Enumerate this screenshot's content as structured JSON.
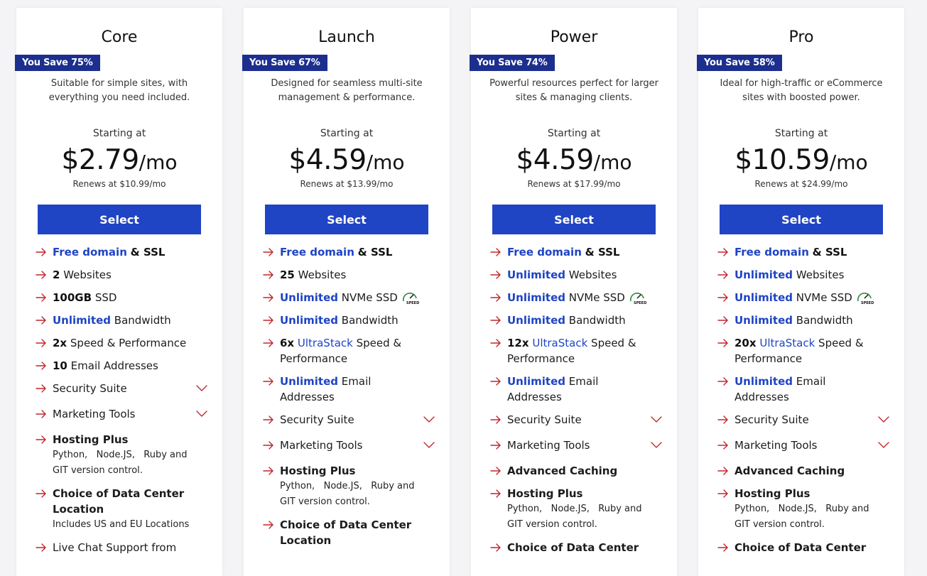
{
  "plans": [
    {
      "name": "Core",
      "badge": "You Save 75%",
      "desc1": "Suitable for simple sites, with",
      "desc2": "everything you need included.",
      "starting": "Starting at",
      "price": "$2.79",
      "per": "/mo",
      "renews": "Renews at $10.99/mo",
      "select": "Select",
      "f_domain": "Free domain",
      "f_ssl": "& SSL",
      "f_sites_n": "2",
      "f_sites": "Websites",
      "f_ssd_a": "100GB",
      "f_ssd_b": "SSD",
      "f_bw_a": "Unlimited",
      "f_bw_b": "Bandwidth",
      "f_speed_a": "2x",
      "f_speed_b": "Speed & Performance",
      "f_email_a": "10",
      "f_email_b": "Email Addresses",
      "f_security": "Security Suite",
      "f_marketing": "Marketing Tools",
      "f_hosting": "Hosting Plus",
      "f_hosting_sub1": "Python,   Node.JS,   Ruby and",
      "f_hosting_sub2": "GIT version control.",
      "f_dc1": "Choice of Data Center",
      "f_dc2": "Location",
      "f_dc_sub": "Includes US and EU Locations",
      "f_chat": "Live Chat Support from"
    },
    {
      "name": "Launch",
      "badge": "You Save 67%",
      "desc1": "Designed for seamless multi-site",
      "desc2": "management & performance.",
      "starting": "Starting at",
      "price": "$4.59",
      "per": "/mo",
      "renews": "Renews at $13.99/mo",
      "select": "Select",
      "f_domain": "Free domain",
      "f_ssl": "& SSL",
      "f_sites_n": "25",
      "f_sites": "Websites",
      "f_ssd_a": "Unlimited",
      "f_ssd_b": "NVMe SSD",
      "f_bw_a": "Unlimited",
      "f_bw_b": "Bandwidth",
      "f_speed_a": "6x",
      "f_speed_link": "UltraStack",
      "f_speed_b": "Speed &",
      "f_speed_c": "Performance",
      "f_email_a": "Unlimited",
      "f_email_b": "Email",
      "f_email_c": "Addresses",
      "f_security": "Security Suite",
      "f_marketing": "Marketing Tools",
      "f_hosting": "Hosting Plus",
      "f_hosting_sub1": "Python,   Node.JS,   Ruby and",
      "f_hosting_sub2": "GIT version control.",
      "f_dc1": "Choice of Data Center",
      "f_dc2": "Location"
    },
    {
      "name": "Power",
      "badge": "You Save 74%",
      "desc1": "Powerful resources perfect for larger",
      "desc2": "sites & managing clients.",
      "starting": "Starting at",
      "price": "$4.59",
      "per": "/mo",
      "renews": "Renews at $17.99/mo",
      "select": "Select",
      "f_domain": "Free domain",
      "f_ssl": "& SSL",
      "f_sites_n": "Unlimited",
      "f_sites": "Websites",
      "f_ssd_a": "Unlimited",
      "f_ssd_b": "NVMe SSD",
      "f_bw_a": "Unlimited",
      "f_bw_b": "Bandwidth",
      "f_speed_a": "12x",
      "f_speed_link": "UltraStack",
      "f_speed_b": "Speed &",
      "f_speed_c": "Performance",
      "f_email_a": "Unlimited",
      "f_email_b": "Email",
      "f_email_c": "Addresses",
      "f_security": "Security Suite",
      "f_marketing": "Marketing Tools",
      "f_caching": "Advanced Caching",
      "f_hosting": "Hosting Plus",
      "f_hosting_sub1": "Python,   Node.JS,   Ruby and",
      "f_hosting_sub2": "GIT version control.",
      "f_dc1": "Choice of Data Center"
    },
    {
      "name": "Pro",
      "badge": "You Save 58%",
      "desc1": "Ideal for high-traffic or eCommerce",
      "desc2": "sites with boosted power.",
      "starting": "Starting at",
      "price": "$10.59",
      "per": "/mo",
      "renews": "Renews at $24.99/mo",
      "select": "Select",
      "f_domain": "Free domain",
      "f_ssl": "& SSL",
      "f_sites_n": "Unlimited",
      "f_sites": "Websites",
      "f_ssd_a": "Unlimited",
      "f_ssd_b": "NVMe SSD",
      "f_bw_a": "Unlimited",
      "f_bw_b": "Bandwidth",
      "f_speed_a": "20x",
      "f_speed_link": "UltraStack",
      "f_speed_b": "Speed &",
      "f_speed_c": "Performance",
      "f_email_a": "Unlimited",
      "f_email_b": "Email",
      "f_email_c": "Addresses",
      "f_security": "Security Suite",
      "f_marketing": "Marketing Tools",
      "f_caching": "Advanced Caching",
      "f_hosting": "Hosting Plus",
      "f_hosting_sub1": "Python,   Node.JS,   Ruby and",
      "f_hosting_sub2": "GIT version control.",
      "f_dc1": "Choice of Data Center"
    }
  ],
  "icons": {
    "arrow": "arrow-right-icon",
    "chevron": "chevron-down-icon",
    "speed": "speed-badge-icon"
  },
  "colors": {
    "accent": "#1f44c4",
    "badge": "#1c2f8e",
    "arrow": "#c0272d"
  }
}
